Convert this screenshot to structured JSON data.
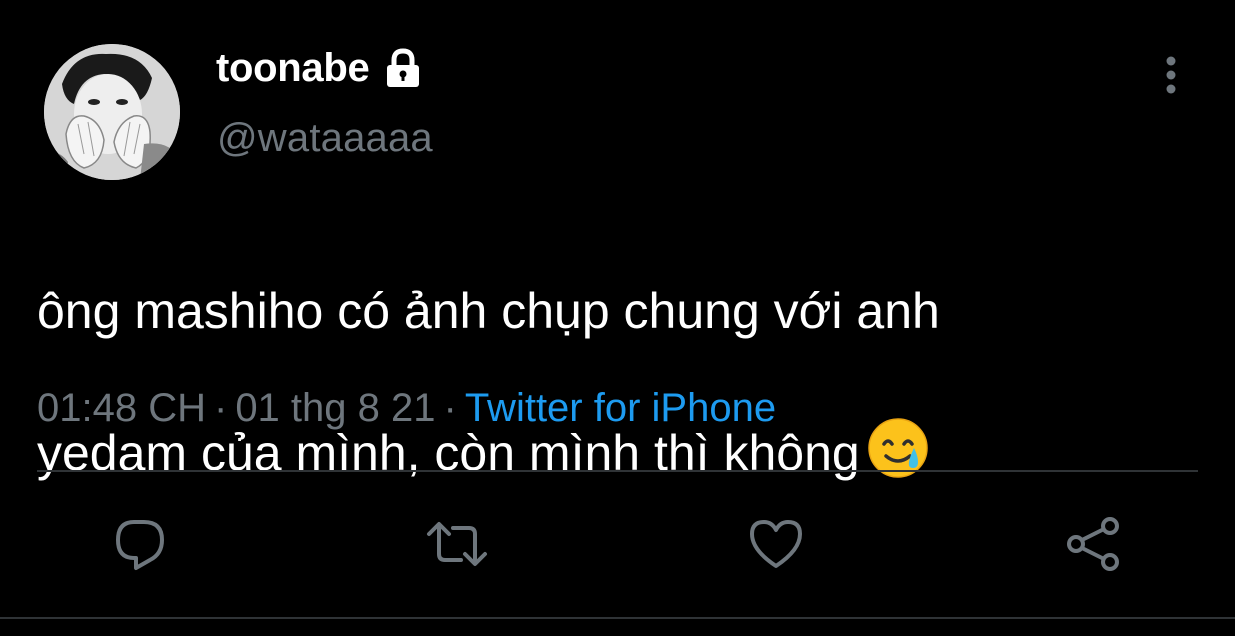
{
  "author": {
    "display_name": "toonabe",
    "handle": "@wataaaaa",
    "protected_icon": "lock-icon"
  },
  "tweet": {
    "text_line_1": "ông mashiho có ảnh chụp chung với anh",
    "text_line_2": "yedam của mình, còn mình thì không",
    "emoji": "smiling-face-with-tear"
  },
  "meta": {
    "time": "01:48 CH",
    "separator": "·",
    "date": "01 thg 8 21",
    "source": "Twitter for iPhone"
  },
  "actions": [
    {
      "icon": "reply-icon"
    },
    {
      "icon": "retweet-icon"
    },
    {
      "icon": "like-icon"
    },
    {
      "icon": "share-icon"
    }
  ],
  "colors": {
    "background": "#000000",
    "primary_text": "#ffffff",
    "secondary_text": "#6e767d",
    "accent": "#1d9bf0",
    "divider": "#2f3336"
  }
}
